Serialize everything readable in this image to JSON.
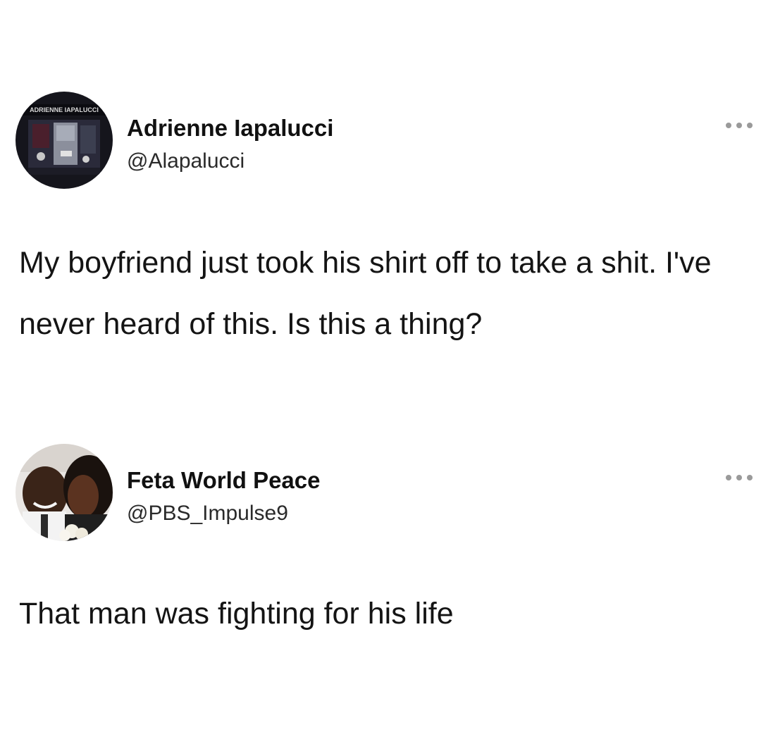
{
  "tweets": [
    {
      "author_name": "Adrienne Iapalucci",
      "author_handle": "@Alapalucci",
      "avatar_text": "ADRIENNE IAPALUCCI",
      "text": "My boyfriend just took his shirt off to take a shit. I've never heard of this. Is this a thing?",
      "more_icon": "more-horizontal-icon"
    },
    {
      "author_name": "Feta World Peace",
      "author_handle": "@PBS_Impulse9",
      "text": "That man was fighting for his life",
      "more_icon": "more-horizontal-icon"
    }
  ],
  "colors": {
    "background": "#ffffff",
    "text": "#141414",
    "icon": "#9a9a9a"
  }
}
